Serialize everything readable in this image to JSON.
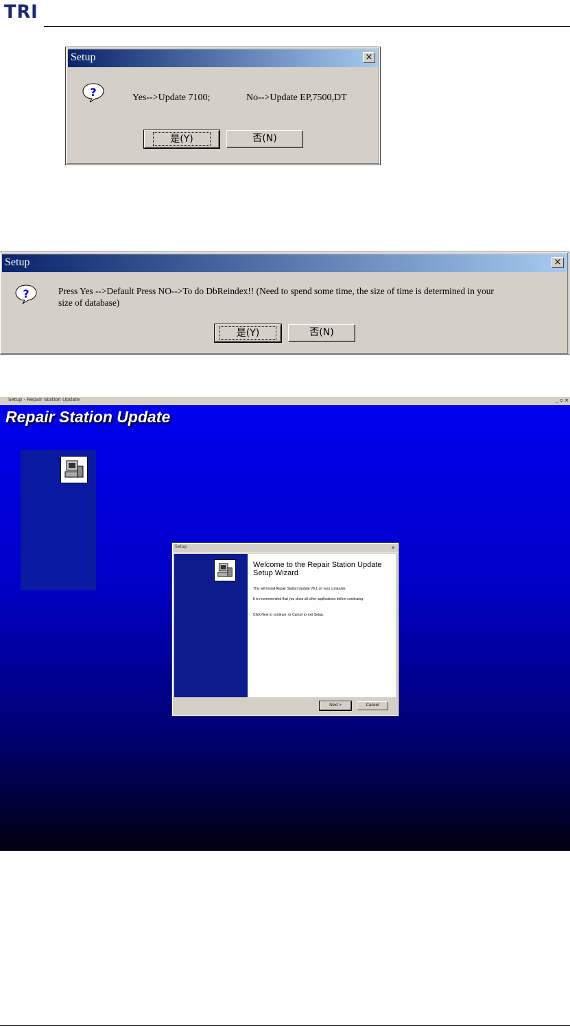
{
  "header": {
    "logo": "TRI"
  },
  "dialog1": {
    "title": "Setup",
    "message_yes": "Yes-->Update 7100;",
    "message_no": "No-->Update EP,7500,DT",
    "yes_label": "是(Y)",
    "no_label": "否(N)",
    "icon": "question-icon"
  },
  "dialog2": {
    "title": "Setup",
    "message_line1": "Press Yes -->Default   Press NO-->To do DbReindex!! (Need to spend some time, the size of time is determined in your",
    "message_line2": "size of database)",
    "yes_label": "是(Y)",
    "no_label": "否(N)",
    "icon": "question-icon"
  },
  "installer": {
    "window_title": "Setup - Repair Station Update",
    "window_controls": "_ ▫ ×",
    "screen_title": "Repair Station Update",
    "wizard": {
      "title": "Setup",
      "heading": "Welcome to the Repair Station Update Setup Wizard",
      "line1": "This will install Repair Station Update V6.1 on your computer.",
      "line2": "It is recommended that you close all other applications before continuing.",
      "line3": "Click Next to continue, or Cancel to exit Setup.",
      "next_label": "Next >",
      "cancel_label": "Cancel"
    }
  },
  "colors": {
    "titlebar_start": "#0a246a",
    "titlebar_end": "#a6caf0",
    "dialog_face": "#d4d0c8",
    "installer_blue": "#0000f0"
  }
}
